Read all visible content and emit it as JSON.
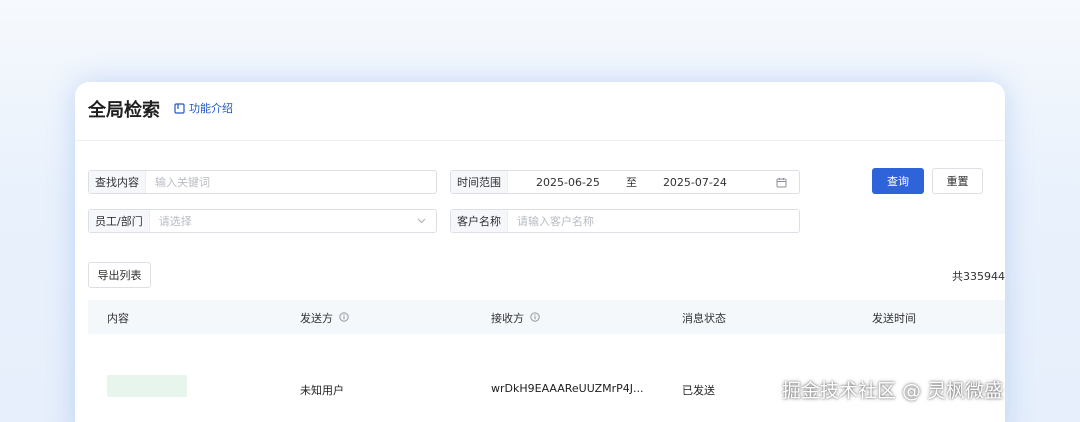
{
  "header": {
    "title": "全局检索",
    "intro_label": "功能介绍"
  },
  "filters": {
    "search": {
      "label": "查找内容",
      "placeholder": "输入关键词"
    },
    "staff": {
      "label": "员工/部门",
      "placeholder": "请选择"
    },
    "time": {
      "label": "时间范围",
      "start": "2025-06-25",
      "separator": "至",
      "end": "2025-07-24"
    },
    "client": {
      "label": "客户名称",
      "placeholder": "请输入客户名称"
    }
  },
  "actions": {
    "query": "查询",
    "reset": "重置",
    "export": "导出列表"
  },
  "total": "共335944",
  "table": {
    "columns": [
      "内容",
      "发送方",
      "接收方",
      "消息状态",
      "发送时间"
    ],
    "rows": [
      {
        "content": "",
        "sender": "未知用户",
        "receiver": "wrDkH9EAAAReUUZMrP4J...",
        "status": "已发送",
        "time": ""
      }
    ]
  },
  "watermark": "掘金技术社区 @ 灵枫微盛",
  "colors": {
    "primary": "#2f63d9",
    "link": "#1f56c6",
    "header_bg": "#f5f8fa"
  },
  "icons": {
    "intro": "book-icon",
    "info": "info-circle-icon",
    "calendar": "calendar-icon",
    "chevron": "chevron-down-icon"
  }
}
